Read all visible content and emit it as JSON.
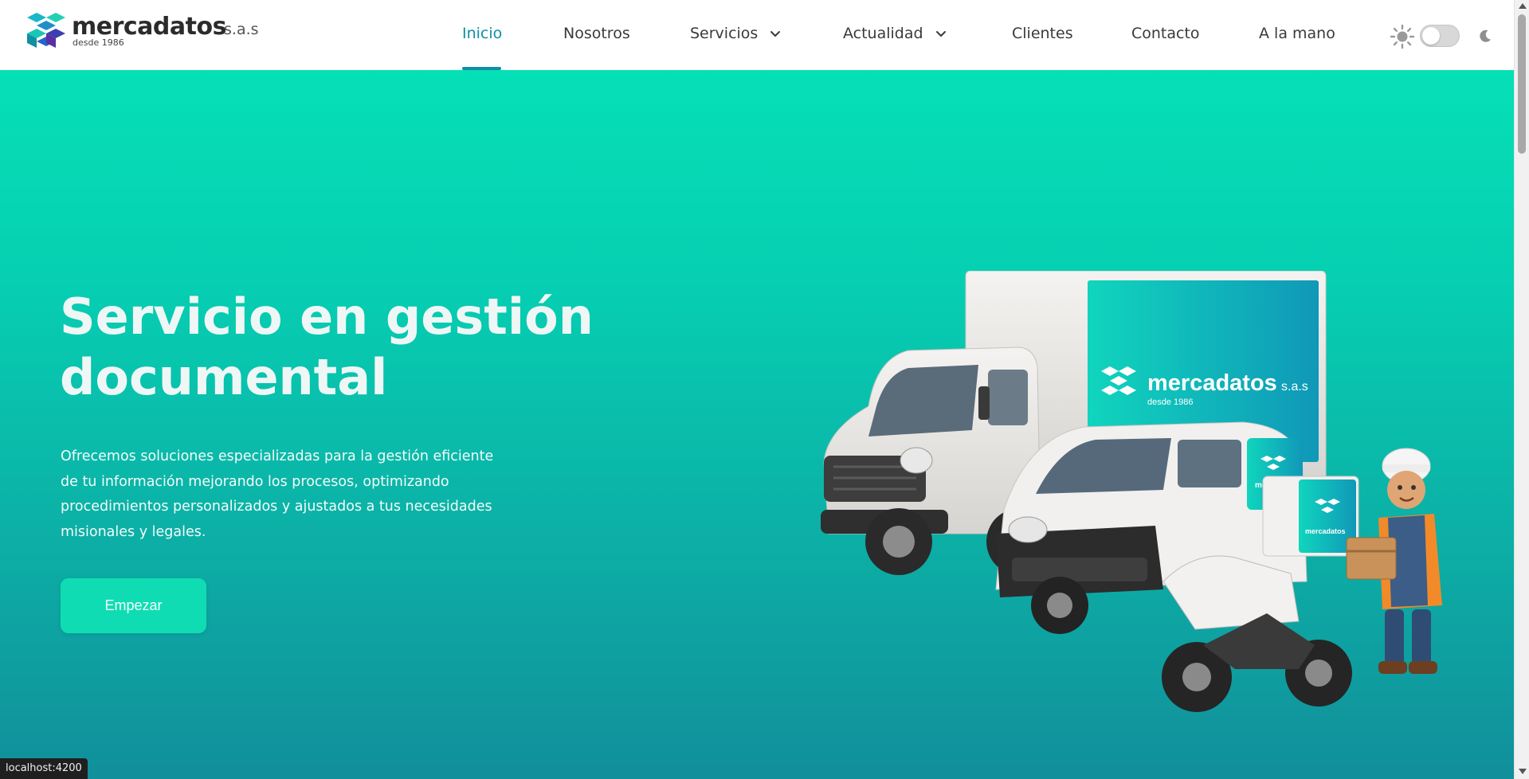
{
  "brand": {
    "name": "mercadatos",
    "suffix": "s.a.s",
    "since": "desde 1986"
  },
  "nav": {
    "items": [
      {
        "label": "Inicio",
        "active": true
      },
      {
        "label": "Nosotros"
      },
      {
        "label": "Servicios",
        "dropdown": true
      },
      {
        "label": "Actualidad",
        "dropdown": true
      },
      {
        "label": "Clientes"
      },
      {
        "label": "Contacto"
      },
      {
        "label": "A la mano"
      }
    ]
  },
  "theme": {
    "light_icon": "sun-icon",
    "dark_icon": "moon-icon",
    "dark_mode": false
  },
  "hero": {
    "title": "Servicio en gestión documental",
    "description": "Ofrecemos soluciones especializadas para la gestión eficiente de tu información mejorando los procesos, optimizando procedimientos personalizados y ajustados a tus necesidades misionales y legales.",
    "cta_label": "Empezar",
    "illustration": {
      "truck_brand": "mercadatos",
      "truck_suffix": "s.a.s",
      "truck_since": "desde 1986",
      "van_brand": "mercadatos",
      "box_brand": "mercadatos"
    }
  },
  "status_bar": {
    "url": "localhost:4200"
  },
  "colors": {
    "accent": "#0f8fa5",
    "hero_top": "#05e0b6",
    "hero_bottom": "#118f9b",
    "button": "#10dcb4"
  }
}
